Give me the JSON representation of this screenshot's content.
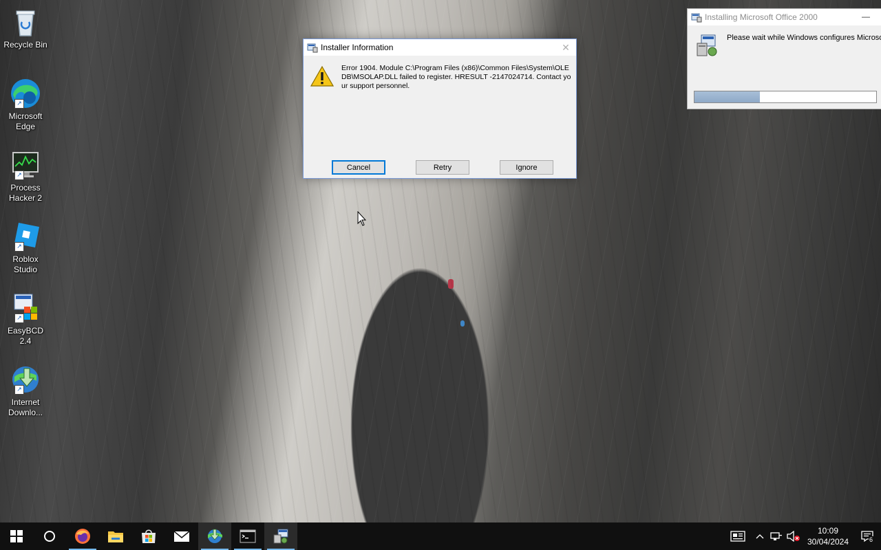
{
  "desktop": {
    "icons": [
      {
        "label": "Recycle Bin",
        "icon": "recycle-bin-icon"
      },
      {
        "label": "Microsoft Edge",
        "icon": "edge-icon"
      },
      {
        "label": "Process Hacker 2",
        "icon": "process-hacker-icon"
      },
      {
        "label": "Roblox Studio",
        "icon": "roblox-studio-icon"
      },
      {
        "label": "EasyBCD 2.4",
        "icon": "easybcd-icon"
      },
      {
        "label": "Internet Downlo...",
        "icon": "internet-download-manager-icon"
      }
    ]
  },
  "installer_dialog": {
    "title": "Installer Information",
    "message": "Error 1904. Module C:\\Program Files (x86)\\Common Files\\System\\OLE DB\\MSOLAP.DLL failed to register.  HRESULT -2147024714.  Contact your support personnel.",
    "buttons": {
      "cancel": "Cancel",
      "retry": "Retry",
      "ignore": "Ignore"
    },
    "default_button": "cancel"
  },
  "office_installer": {
    "title": "Installing Microsoft Office 2000",
    "message": "Please wait while Windows configures Microsof",
    "progress": 0.36
  },
  "taskbar": {
    "items": [
      {
        "icon": "windows-start-icon"
      },
      {
        "icon": "cortana-search-icon"
      },
      {
        "icon": "firefox-icon",
        "running": true
      },
      {
        "icon": "file-explorer-icon"
      },
      {
        "icon": "microsoft-store-icon"
      },
      {
        "icon": "mail-icon"
      },
      {
        "icon": "internet-download-manager-icon",
        "running": true,
        "active": true
      },
      {
        "icon": "command-prompt-icon",
        "running": true
      },
      {
        "icon": "windows-installer-icon",
        "running": true
      }
    ],
    "clock": {
      "time": "10:09",
      "date": "30/04/2024"
    },
    "notifications_count": "6"
  },
  "colors": {
    "taskbar_bg": "#101010",
    "accent": "#0078d7",
    "progress_fill": "#9db4d0"
  }
}
